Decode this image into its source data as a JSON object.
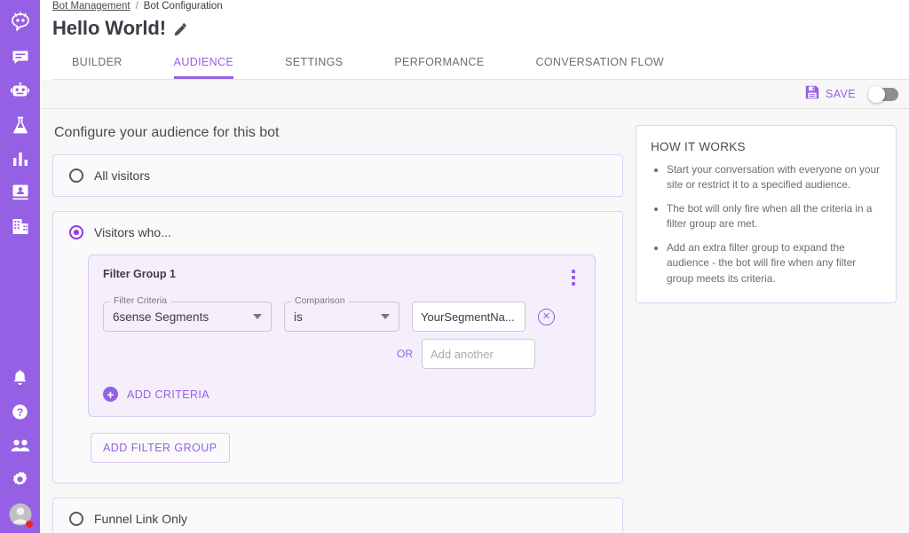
{
  "sidebar": {
    "top_items": [
      {
        "name": "logo",
        "icon": "bot-logo-icon"
      },
      {
        "name": "conversations",
        "icon": "chat-bubble-icon"
      },
      {
        "name": "bots",
        "icon": "robot-icon"
      },
      {
        "name": "experiments",
        "icon": "flask-icon"
      },
      {
        "name": "reports",
        "icon": "bar-chart-icon"
      },
      {
        "name": "contacts",
        "icon": "contact-card-icon"
      },
      {
        "name": "accounts",
        "icon": "building-icon"
      }
    ],
    "bottom_items": [
      {
        "name": "notifications",
        "icon": "bell-icon"
      },
      {
        "name": "help",
        "icon": "question-circle-icon"
      },
      {
        "name": "team",
        "icon": "people-icon"
      },
      {
        "name": "settings",
        "icon": "gear-icon"
      },
      {
        "name": "profile",
        "icon": "avatar-icon"
      }
    ],
    "accent_color": "#9560e4",
    "status_dot_color": "#e8282b"
  },
  "breadcrumb": {
    "parent": "Bot Management",
    "separator": "/",
    "current": "Bot Configuration"
  },
  "header": {
    "title": "Hello World!",
    "edit_icon": "pencil-icon"
  },
  "tabs": [
    {
      "label": "BUILDER",
      "active": false
    },
    {
      "label": "AUDIENCE",
      "active": true
    },
    {
      "label": "SETTINGS",
      "active": false
    },
    {
      "label": "PERFORMANCE",
      "active": false
    },
    {
      "label": "CONVERSATION FLOW",
      "active": false
    }
  ],
  "actionbar": {
    "save_label": "SAVE",
    "save_icon": "floppy-disk-icon",
    "toggle_state": "off"
  },
  "main": {
    "section_title": "Configure your audience for this bot",
    "options": [
      {
        "label": "All visitors",
        "selected": false
      },
      {
        "label": "Visitors who...",
        "selected": true
      },
      {
        "label": "Funnel Link Only",
        "selected": false
      }
    ],
    "filter_group": {
      "title": "Filter Group 1",
      "menu_icon": "kebab-menu-icon",
      "criteria_legend": "Filter Criteria",
      "criteria_value": "6sense Segments",
      "comparison_legend": "Comparison",
      "comparison_value": "is",
      "value_text": "YourSegmentNa...",
      "or_label": "OR",
      "or_placeholder": "Add another",
      "delete_icon": "circle-x-icon",
      "add_criteria_label": "ADD CRITERIA",
      "add_criteria_icon": "plus-circle-icon"
    },
    "add_filter_group_label": "ADD FILTER GROUP"
  },
  "how_it_works": {
    "title": "HOW IT WORKS",
    "bullets": [
      "Start your conversation with everyone on your site or restrict it to a specified audience.",
      "The bot will only fire when all the criteria in a filter group are met.",
      "Add an extra filter group to expand the audience - the bot will fire when any filter group meets its criteria."
    ]
  }
}
